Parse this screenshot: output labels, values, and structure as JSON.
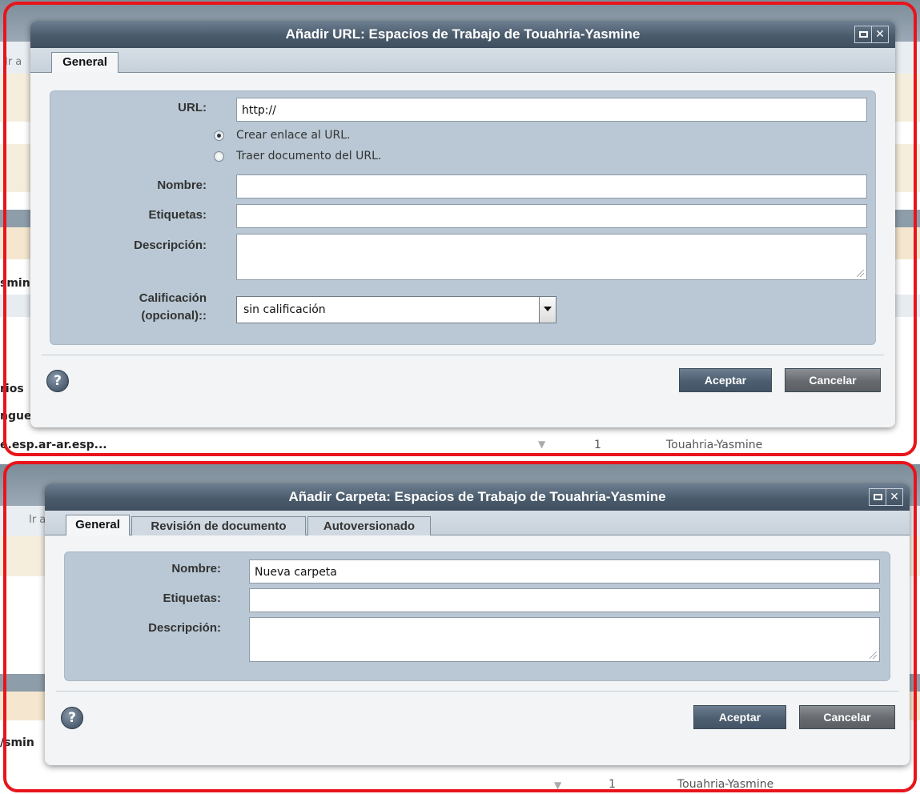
{
  "background": {
    "text_lines": [
      "Ir a",
      "smin",
      "rios",
      "ngue",
      "e.esp.ar-ar.esp...",
      "1",
      "Touahria-Yasmine",
      "Ir a",
      "/smin",
      "1",
      "Touahria-Yasmine"
    ]
  },
  "url_dialog": {
    "title": "Añadir URL: Espacios de Trabajo de Touahria-Yasmine",
    "tabs": [
      {
        "label": "General"
      }
    ],
    "url_label": "URL:",
    "url_value": "http://",
    "radio_link": "Crear enlace al URL.",
    "radio_fetch": "Traer documento del URL.",
    "name_label": "Nombre:",
    "name_value": "",
    "tags_label": "Etiquetas:",
    "tags_value": "",
    "desc_label": "Descripción:",
    "desc_value": "",
    "rating_label_1": "Calificación",
    "rating_label_2": "(opcional)::",
    "rating_value": "sin calificación",
    "ok_label": "Aceptar",
    "cancel_label": "Cancelar",
    "help_glyph": "?"
  },
  "folder_dialog": {
    "title": "Añadir Carpeta: Espacios de Trabajo de Touahria-Yasmine",
    "tabs": [
      {
        "label": "General"
      },
      {
        "label": "Revisión de documento"
      },
      {
        "label": "Autoversionado"
      }
    ],
    "name_label": "Nombre:",
    "name_value": "Nueva carpeta",
    "tags_label": "Etiquetas:",
    "tags_value": "",
    "desc_label": "Descripción:",
    "desc_value": "",
    "ok_label": "Aceptar",
    "cancel_label": "Cancelar",
    "help_glyph": "?"
  },
  "colors": {
    "highlight_frame": "#e8141c",
    "titlebar": "#4a5b6c",
    "panel": "#b9c8d4"
  }
}
